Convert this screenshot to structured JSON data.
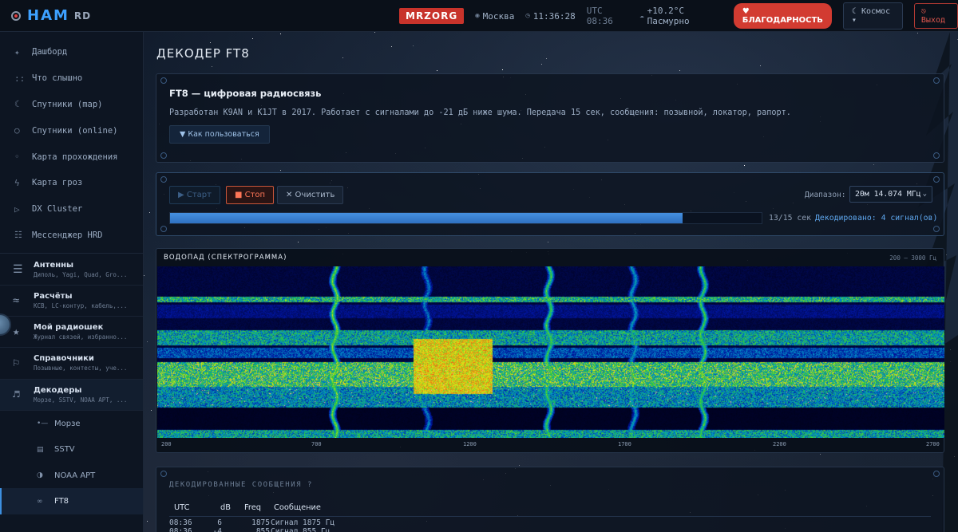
{
  "header": {
    "logo_main": "HAM",
    "logo_sub": "RD",
    "callsign": "MRZORG",
    "city": "Москва",
    "time": "11:36:28",
    "utc": "UTC 08:36",
    "weather": "+10.2°C Пасмурно",
    "thanks_label": "БЛАГОДАРНОСТЬ",
    "theme_label": "Космос",
    "logout_label": "Выход"
  },
  "sidebar": {
    "items": [
      {
        "icon": "✦",
        "label": "Дашборд"
      },
      {
        "icon": "::",
        "label": "Что слышно"
      },
      {
        "icon": "☾",
        "label": "Спутники (map)"
      },
      {
        "icon": "○",
        "label": "Спутники (online)"
      },
      {
        "icon": "◦",
        "label": "Карта прохождения"
      },
      {
        "icon": "ϟ",
        "label": "Карта гроз"
      },
      {
        "icon": "▷",
        "label": "DX Cluster"
      },
      {
        "icon": "☷",
        "label": "Мессенджер HRD"
      }
    ],
    "groups": [
      {
        "icon": "☰",
        "title": "Антенны",
        "subtitle": "Диполь, Yagi, Quad, Gro..."
      },
      {
        "icon": "≈",
        "title": "Расчёты",
        "subtitle": "КСВ, LC-контур, кабель,..."
      },
      {
        "icon": "★",
        "title": "Мой радиошек",
        "subtitle": "Журнал связей, избранно..."
      },
      {
        "icon": "⚐",
        "title": "Справочники",
        "subtitle": "Позывные, контесты, уче..."
      },
      {
        "icon": "♬",
        "title": "Декодеры",
        "subtitle": "Морзе, SSTV, NOAA APT, ..."
      }
    ],
    "subitems": [
      {
        "icon": "•—",
        "label": "Морзе"
      },
      {
        "icon": "▤",
        "label": "SSTV"
      },
      {
        "icon": "◑",
        "label": "NOAA APT"
      },
      {
        "icon": "∞",
        "label": "FT8"
      }
    ]
  },
  "page": {
    "title": "ДЕКОДЕР FT8"
  },
  "info": {
    "title": "FT8 — цифровая радиосвязь",
    "text": "Разработан K9AN и K1JT в 2017. Работает с сигналами до -21 дБ ниже шума. Передача 15 сек, сообщения: позывной, локатор, рапорт.",
    "howto_label": "▼ Как пользоваться"
  },
  "controls": {
    "start_label": "▶ Старт",
    "stop_label": "■ Стоп",
    "clear_label": "✕ Очистить",
    "range_label": "Диапазон:",
    "range_value": "20м 14.074 МГц",
    "progress": 0.867,
    "progress_text": "13/15 сек",
    "decoded_text": "Декодировано: 4 сигнал(ов)"
  },
  "waterfall": {
    "title": "ВОДОПАД (СПЕКТРОГРАММА)",
    "range": "200 — 3000 Гц",
    "ticks": [
      "200",
      "700",
      "1200",
      "1700",
      "2200",
      "2700"
    ]
  },
  "messages": {
    "title": "ДЕКОДИРОВАННЫЕ СООБЩЕНИЯ ?",
    "headers": [
      "UTC",
      "dB",
      "Freq",
      "Сообщение"
    ],
    "rows": [
      [
        "08:36",
        "6",
        "1875",
        "Сигнал 1875 Гц"
      ],
      [
        "08:36",
        "-4",
        "855",
        "Сигнал 855 Гц"
      ]
    ]
  }
}
